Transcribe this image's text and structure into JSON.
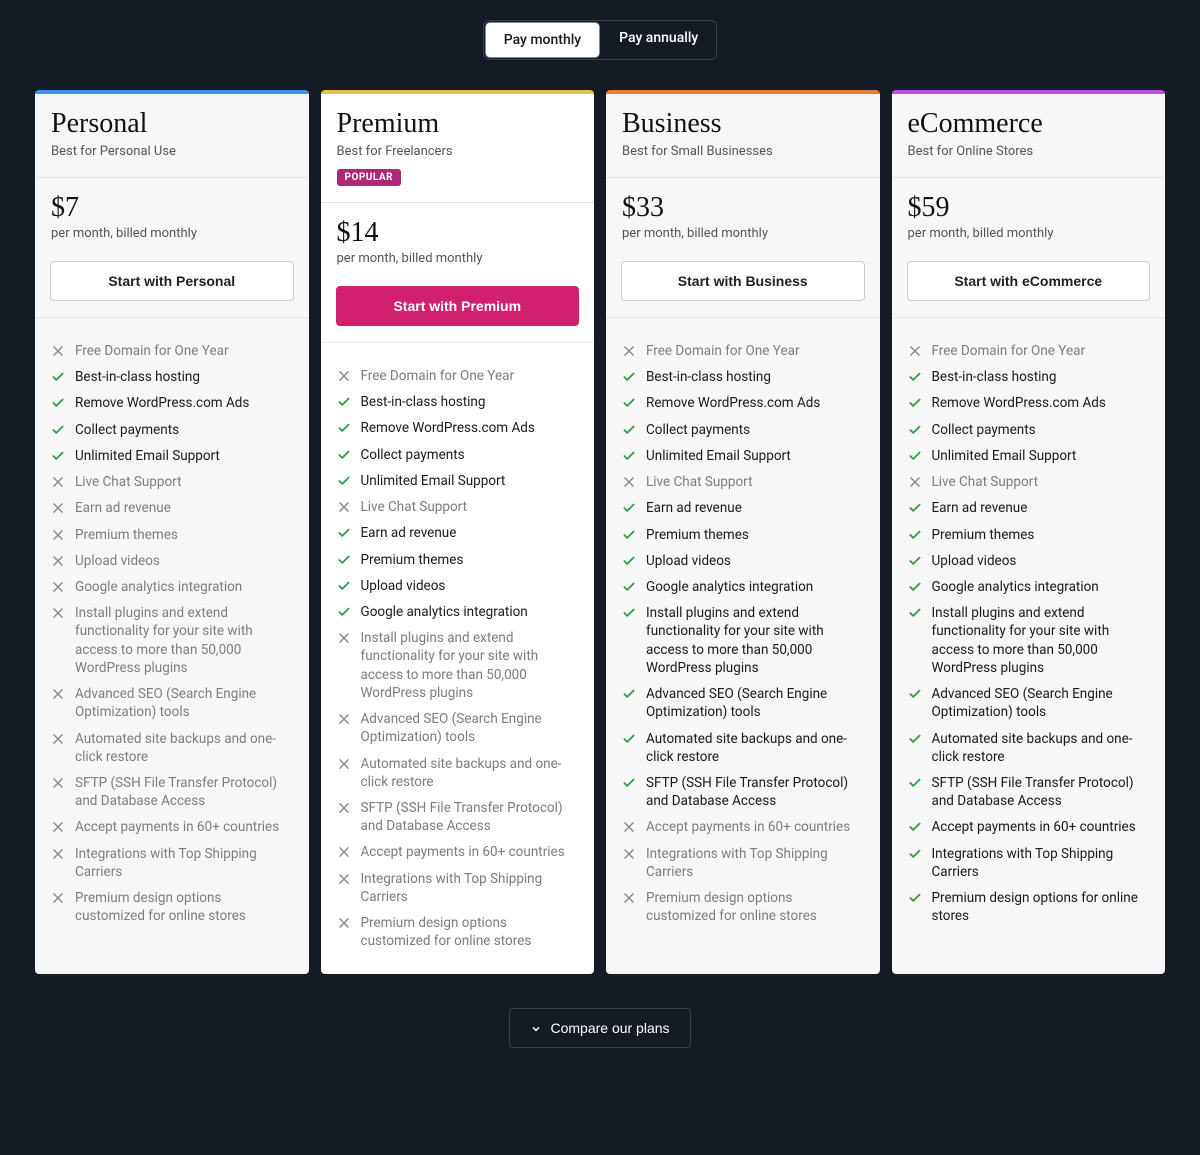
{
  "toggle": {
    "monthly": "Pay monthly",
    "annually": "Pay annually",
    "active": "monthly"
  },
  "feature_labels": [
    "Free Domain for One Year",
    "Best-in-class hosting",
    "Remove WordPress.com Ads",
    "Collect payments",
    "Unlimited Email Support",
    "Live Chat Support",
    "Earn ad revenue",
    "Premium themes",
    "Upload videos",
    "Google analytics integration",
    "Install plugins and extend functionality for your site with access to more than 50,000 WordPress plugins",
    "Advanced SEO (Search Engine Optimization) tools",
    "Automated site backups and one-click restore",
    "SFTP (SSH File Transfer Protocol) and Database Access",
    "Accept payments in 60+ countries",
    "Integrations with Top Shipping Carriers",
    "Premium design options customized for online stores"
  ],
  "ecommerce_last_feature_label": "Premium design options for online stores",
  "plans": [
    {
      "key": "personal",
      "name": "Personal",
      "sub": "Best for Personal Use",
      "price": "$7",
      "price_sub": "per month, billed monthly",
      "cta": "Start with Personal",
      "accent": "#448ee8",
      "featured": false,
      "features": [
        false,
        true,
        true,
        true,
        true,
        false,
        false,
        false,
        false,
        false,
        false,
        false,
        false,
        false,
        false,
        false,
        false
      ]
    },
    {
      "key": "premium",
      "name": "Premium",
      "sub": "Best for Freelancers",
      "badge": "POPULAR",
      "price": "$14",
      "price_sub": "per month, billed monthly",
      "cta": "Start with Premium",
      "accent": "#dfc240",
      "featured": true,
      "features": [
        false,
        true,
        true,
        true,
        true,
        false,
        true,
        true,
        true,
        true,
        false,
        false,
        false,
        false,
        false,
        false,
        false
      ]
    },
    {
      "key": "business",
      "name": "Business",
      "sub": "Best for Small Businesses",
      "price": "$33",
      "price_sub": "per month, billed monthly",
      "cta": "Start with Business",
      "accent": "#e37e3b",
      "featured": false,
      "features": [
        false,
        true,
        true,
        true,
        true,
        false,
        true,
        true,
        true,
        true,
        true,
        true,
        true,
        true,
        false,
        false,
        false
      ]
    },
    {
      "key": "ecommerce",
      "name": "eCommerce",
      "sub": "Best for Online Stores",
      "price": "$59",
      "price_sub": "per month, billed monthly",
      "cta": "Start with eCommerce",
      "accent": "#b950e0",
      "featured": false,
      "features": [
        false,
        true,
        true,
        true,
        true,
        false,
        true,
        true,
        true,
        true,
        true,
        true,
        true,
        true,
        true,
        true,
        true
      ]
    }
  ],
  "compare_label": "Compare our plans"
}
